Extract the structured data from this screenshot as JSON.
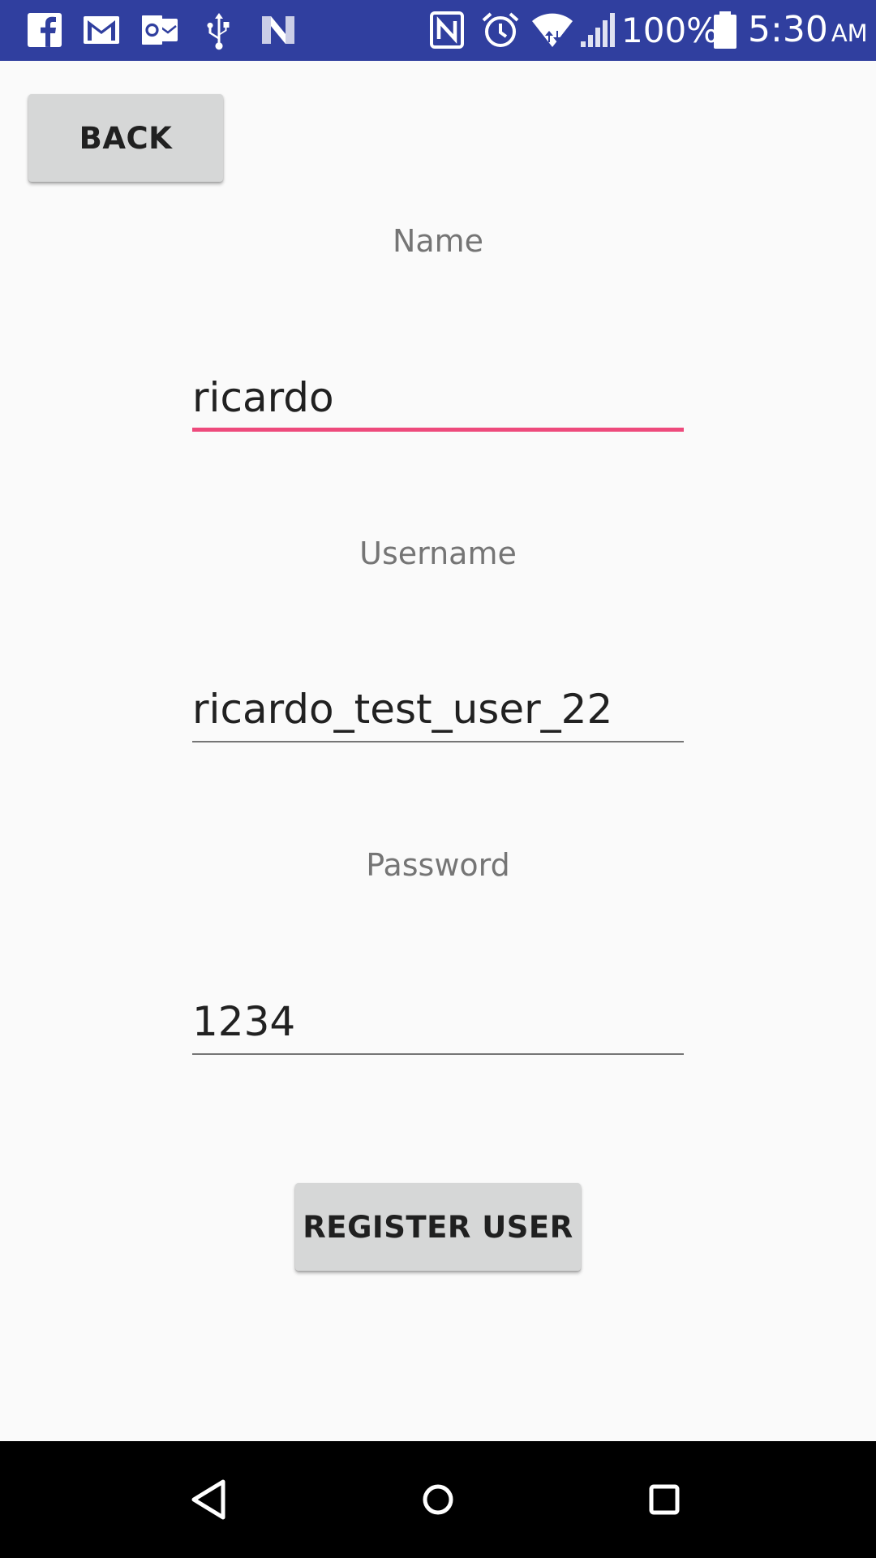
{
  "status_bar": {
    "battery_percent": "100%",
    "time": "5:30",
    "ampm": "AM",
    "background": "#303f9f",
    "left_icons": [
      "facebook-icon",
      "gmail-icon",
      "outlook-icon",
      "usb-icon",
      "n-app-icon"
    ],
    "right_icons": [
      "nfc-icon",
      "alarm-icon",
      "wifi-icon",
      "signal-icon",
      "battery-icon"
    ]
  },
  "toolbar": {
    "back_label": "BACK"
  },
  "form": {
    "name_label": "Name",
    "name_value": "ricardo",
    "username_label": "Username",
    "username_value": "ricardo_test_user_22",
    "password_label": "Password",
    "password_value": "1234",
    "register_label": "REGISTER USER",
    "focus_color": "#ee4a7c"
  },
  "nav_bar": {
    "icons": [
      "back-triangle-icon",
      "home-circle-icon",
      "recents-square-icon"
    ]
  }
}
